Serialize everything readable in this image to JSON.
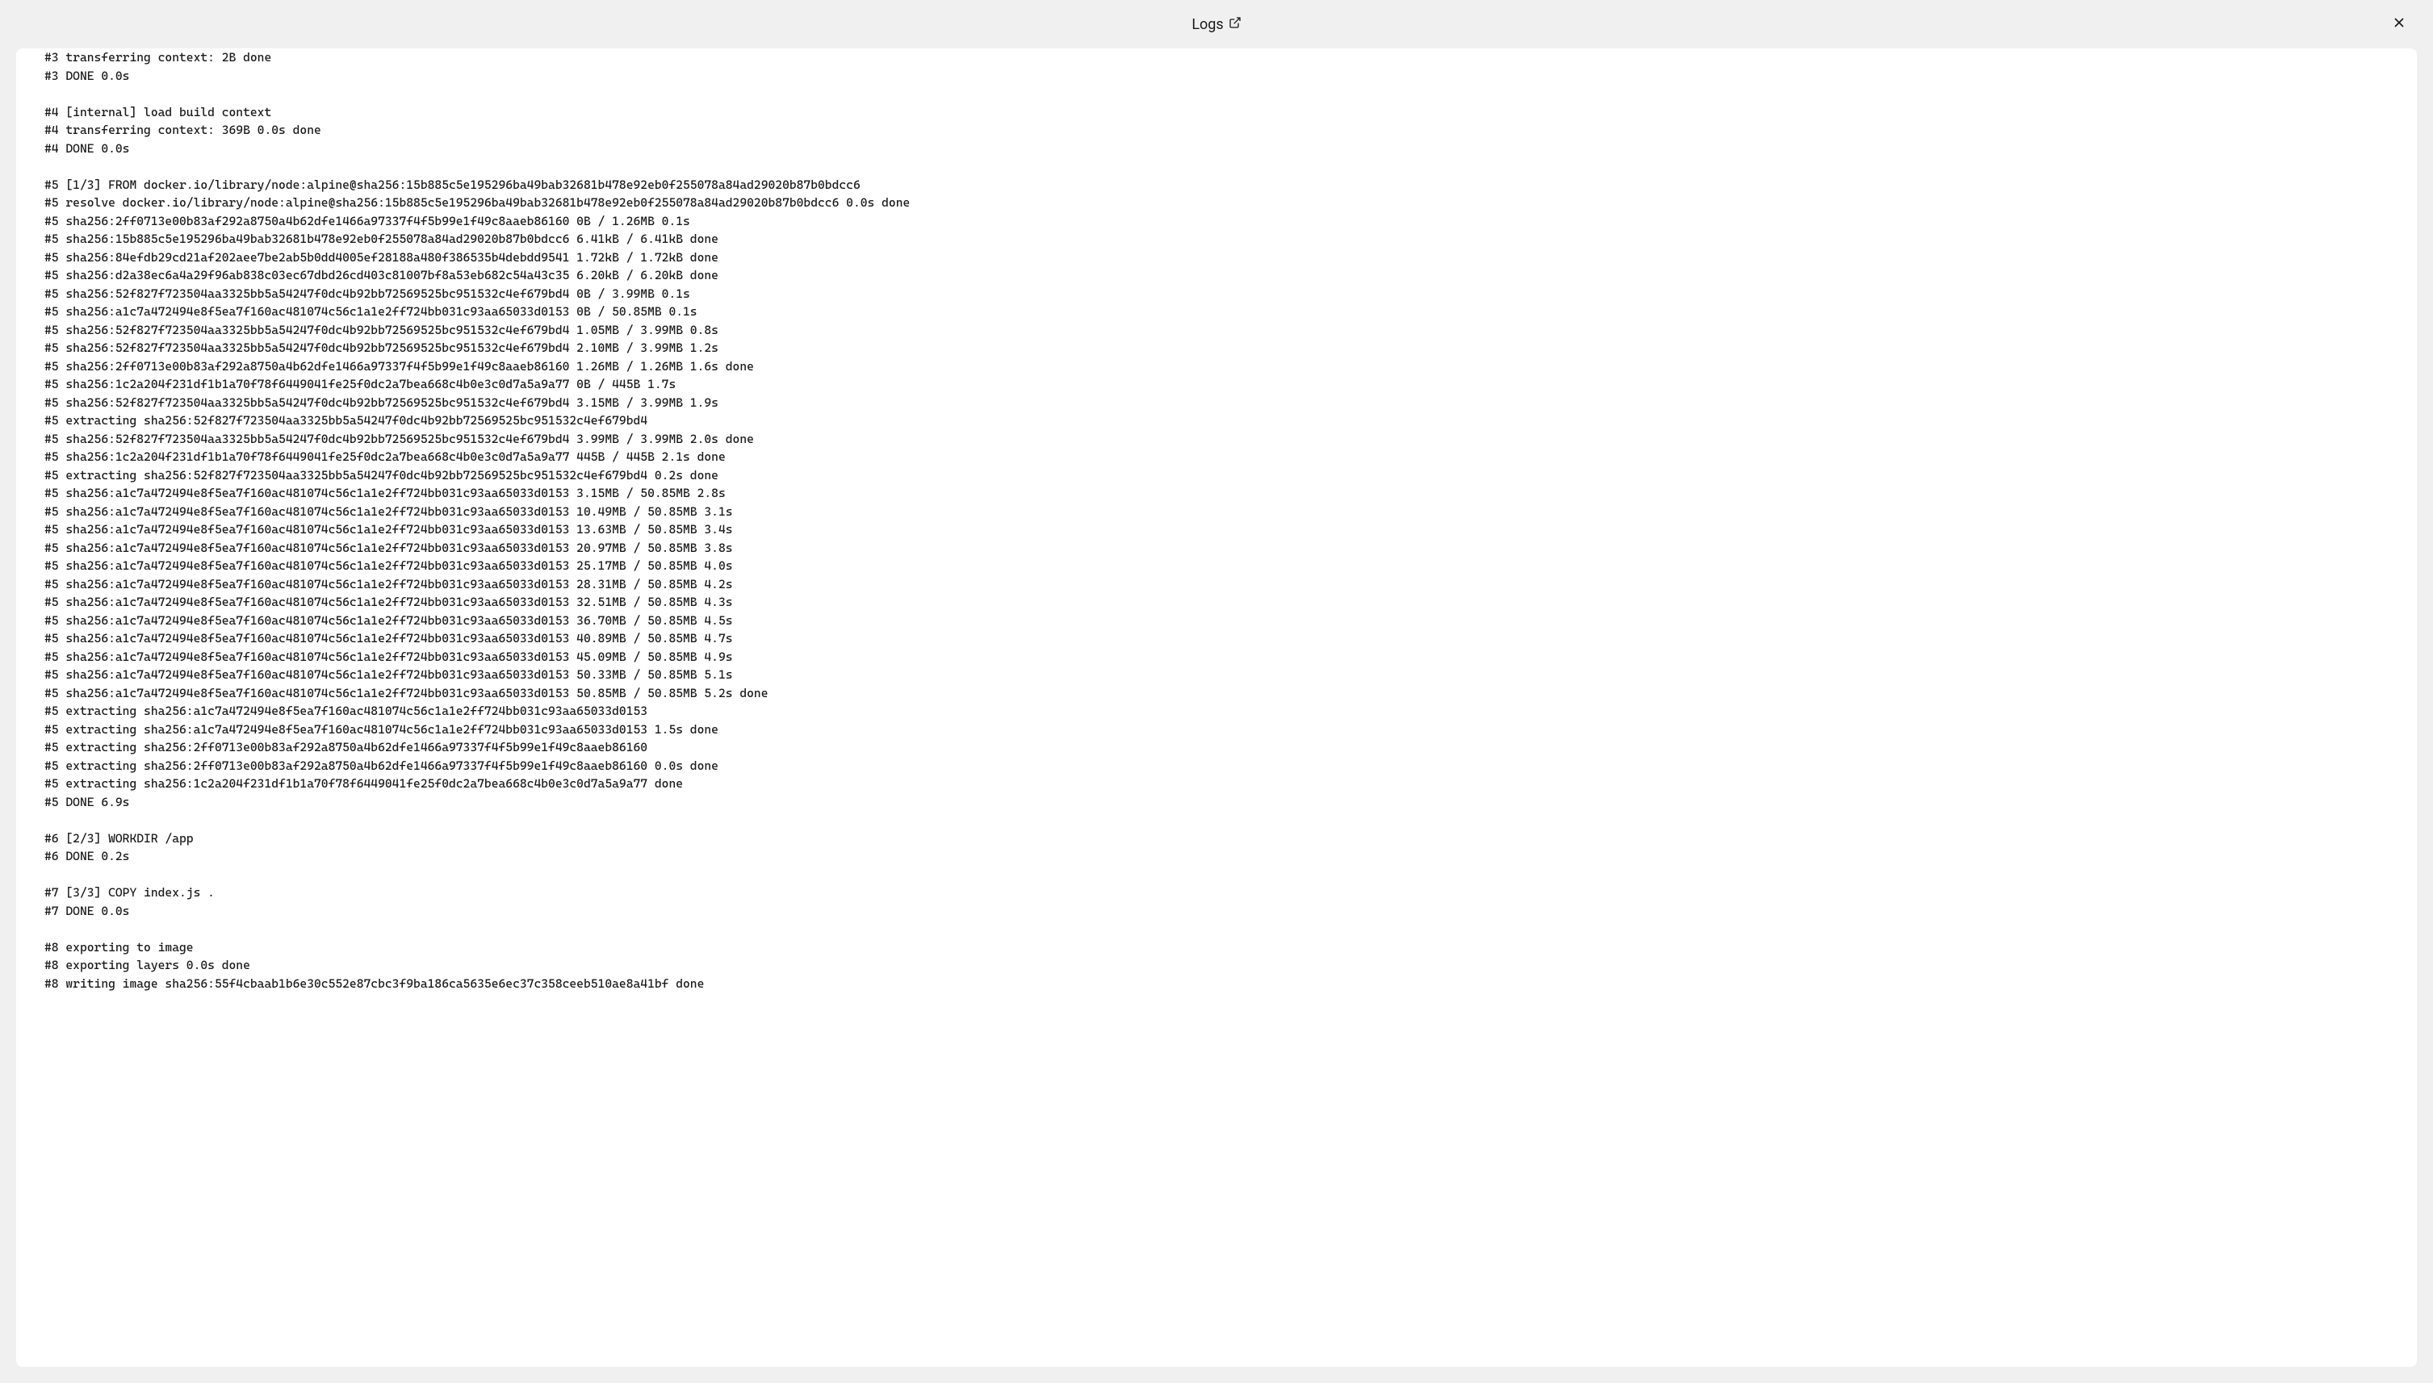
{
  "header": {
    "title": "Logs"
  },
  "logs": {
    "lines": [
      "#3 transferring context: 2B done",
      "#3 DONE 0.0s",
      "",
      "#4 [internal] load build context",
      "#4 transferring context: 369B 0.0s done",
      "#4 DONE 0.0s",
      "",
      "#5 [1/3] FROM docker.io/library/node:alpine@sha256:15b885c5e195296ba49bab32681b478e92eb0f255078a84ad29020b87b0bdcc6",
      "#5 resolve docker.io/library/node:alpine@sha256:15b885c5e195296ba49bab32681b478e92eb0f255078a84ad29020b87b0bdcc6 0.0s done",
      "#5 sha256:2ff0713e00b83af292a8750a4b62dfe1466a97337f4f5b99e1f49c8aaeb86160 0B / 1.26MB 0.1s",
      "#5 sha256:15b885c5e195296ba49bab32681b478e92eb0f255078a84ad29020b87b0bdcc6 6.41kB / 6.41kB done",
      "#5 sha256:84efdb29cd21af202aee7be2ab5b0dd4005ef28188a480f386535b4debdd9541 1.72kB / 1.72kB done",
      "#5 sha256:d2a38ec6a4a29f96ab838c03ec67dbd26cd403c81007bf8a53eb682c54a43c35 6.20kB / 6.20kB done",
      "#5 sha256:52f827f723504aa3325bb5a54247f0dc4b92bb72569525bc951532c4ef679bd4 0B / 3.99MB 0.1s",
      "#5 sha256:a1c7a472494e8f5ea7f160ac481074c56c1a1e2ff724bb031c93aa65033d0153 0B / 50.85MB 0.1s",
      "#5 sha256:52f827f723504aa3325bb5a54247f0dc4b92bb72569525bc951532c4ef679bd4 1.05MB / 3.99MB 0.8s",
      "#5 sha256:52f827f723504aa3325bb5a54247f0dc4b92bb72569525bc951532c4ef679bd4 2.10MB / 3.99MB 1.2s",
      "#5 sha256:2ff0713e00b83af292a8750a4b62dfe1466a97337f4f5b99e1f49c8aaeb86160 1.26MB / 1.26MB 1.6s done",
      "#5 sha256:1c2a204f231df1b1a70f78f6449041fe25f0dc2a7bea668c4b0e3c0d7a5a9a77 0B / 445B 1.7s",
      "#5 sha256:52f827f723504aa3325bb5a54247f0dc4b92bb72569525bc951532c4ef679bd4 3.15MB / 3.99MB 1.9s",
      "#5 extracting sha256:52f827f723504aa3325bb5a54247f0dc4b92bb72569525bc951532c4ef679bd4",
      "#5 sha256:52f827f723504aa3325bb5a54247f0dc4b92bb72569525bc951532c4ef679bd4 3.99MB / 3.99MB 2.0s done",
      "#5 sha256:1c2a204f231df1b1a70f78f6449041fe25f0dc2a7bea668c4b0e3c0d7a5a9a77 445B / 445B 2.1s done",
      "#5 extracting sha256:52f827f723504aa3325bb5a54247f0dc4b92bb72569525bc951532c4ef679bd4 0.2s done",
      "#5 sha256:a1c7a472494e8f5ea7f160ac481074c56c1a1e2ff724bb031c93aa65033d0153 3.15MB / 50.85MB 2.8s",
      "#5 sha256:a1c7a472494e8f5ea7f160ac481074c56c1a1e2ff724bb031c93aa65033d0153 10.49MB / 50.85MB 3.1s",
      "#5 sha256:a1c7a472494e8f5ea7f160ac481074c56c1a1e2ff724bb031c93aa65033d0153 13.63MB / 50.85MB 3.4s",
      "#5 sha256:a1c7a472494e8f5ea7f160ac481074c56c1a1e2ff724bb031c93aa65033d0153 20.97MB / 50.85MB 3.8s",
      "#5 sha256:a1c7a472494e8f5ea7f160ac481074c56c1a1e2ff724bb031c93aa65033d0153 25.17MB / 50.85MB 4.0s",
      "#5 sha256:a1c7a472494e8f5ea7f160ac481074c56c1a1e2ff724bb031c93aa65033d0153 28.31MB / 50.85MB 4.2s",
      "#5 sha256:a1c7a472494e8f5ea7f160ac481074c56c1a1e2ff724bb031c93aa65033d0153 32.51MB / 50.85MB 4.3s",
      "#5 sha256:a1c7a472494e8f5ea7f160ac481074c56c1a1e2ff724bb031c93aa65033d0153 36.70MB / 50.85MB 4.5s",
      "#5 sha256:a1c7a472494e8f5ea7f160ac481074c56c1a1e2ff724bb031c93aa65033d0153 40.89MB / 50.85MB 4.7s",
      "#5 sha256:a1c7a472494e8f5ea7f160ac481074c56c1a1e2ff724bb031c93aa65033d0153 45.09MB / 50.85MB 4.9s",
      "#5 sha256:a1c7a472494e8f5ea7f160ac481074c56c1a1e2ff724bb031c93aa65033d0153 50.33MB / 50.85MB 5.1s",
      "#5 sha256:a1c7a472494e8f5ea7f160ac481074c56c1a1e2ff724bb031c93aa65033d0153 50.85MB / 50.85MB 5.2s done",
      "#5 extracting sha256:a1c7a472494e8f5ea7f160ac481074c56c1a1e2ff724bb031c93aa65033d0153",
      "#5 extracting sha256:a1c7a472494e8f5ea7f160ac481074c56c1a1e2ff724bb031c93aa65033d0153 1.5s done",
      "#5 extracting sha256:2ff0713e00b83af292a8750a4b62dfe1466a97337f4f5b99e1f49c8aaeb86160",
      "#5 extracting sha256:2ff0713e00b83af292a8750a4b62dfe1466a97337f4f5b99e1f49c8aaeb86160 0.0s done",
      "#5 extracting sha256:1c2a204f231df1b1a70f78f6449041fe25f0dc2a7bea668c4b0e3c0d7a5a9a77 done",
      "#5 DONE 6.9s",
      "",
      "#6 [2/3] WORKDIR /app",
      "#6 DONE 0.2s",
      "",
      "#7 [3/3] COPY index.js .",
      "#7 DONE 0.0s",
      "",
      "#8 exporting to image",
      "#8 exporting layers 0.0s done",
      "#8 writing image sha256:55f4cbaab1b6e30c552e87cbc3f9ba186ca5635e6ec37c358ceeb510ae8a41bf done"
    ]
  }
}
